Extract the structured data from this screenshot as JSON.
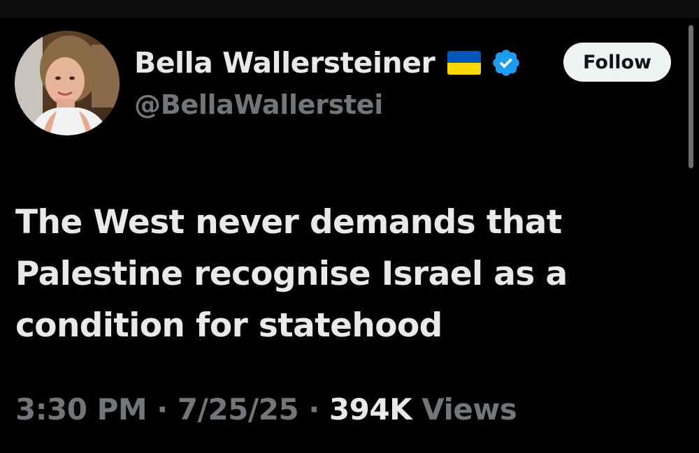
{
  "author": {
    "display_name": "Bella Wallersteiner",
    "handle": "@BellaWallerstei",
    "flag": "ukraine-flag-icon",
    "verified_badge": "verified-badge-icon",
    "avatar": "profile-photo"
  },
  "follow_button": {
    "label": "Follow"
  },
  "tweet": {
    "lines": [
      "The West never demands that",
      "Palestine recognise Israel as a",
      "condition for statehood"
    ]
  },
  "meta": {
    "time": "3:30 PM",
    "separator": "·",
    "date": "7/25/25",
    "views_count": "394K",
    "views_label": "Views"
  },
  "colors": {
    "background": "#000000",
    "text_primary": "#e7e9ea",
    "text_secondary": "#71767b",
    "verified_blue": "#1d9bf0",
    "follow_bg": "#eff3f4",
    "flag_blue": "#0057b7",
    "flag_yellow": "#ffd700"
  }
}
